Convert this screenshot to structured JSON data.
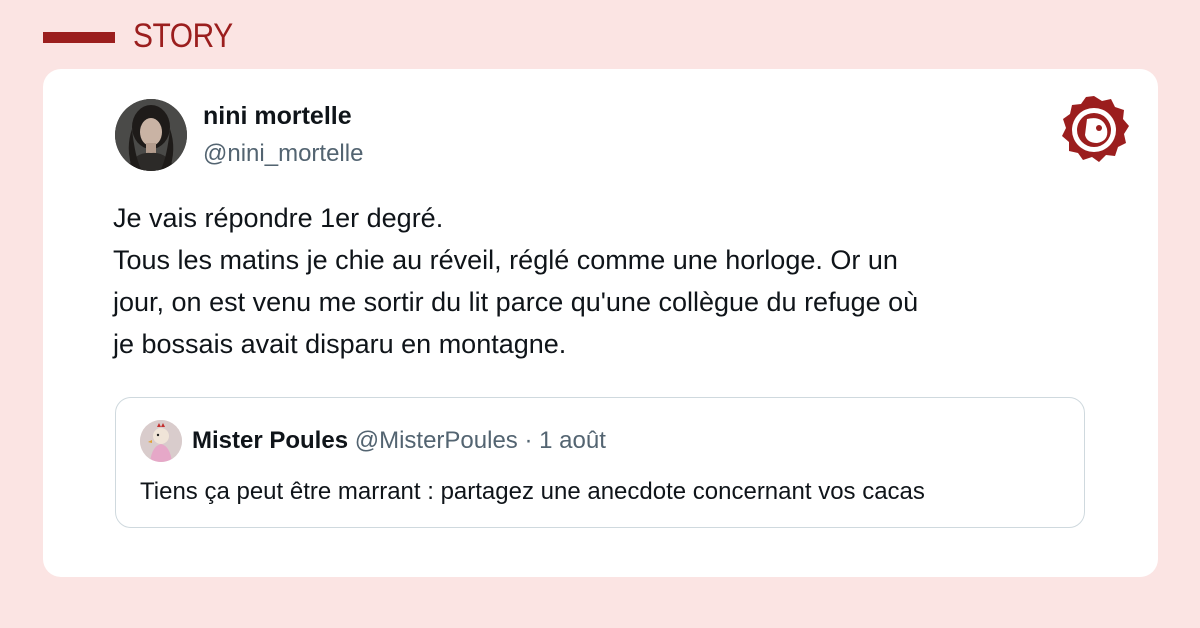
{
  "section": {
    "label": "STORY"
  },
  "tweet": {
    "author_name": "nini mortelle",
    "author_handle": "@nini_mortelle",
    "text_lines": [
      "Je vais répondre 1er degré.",
      "Tous les matins je chie au réveil, réglé comme une horloge. Or un",
      "jour, on est venu me sortir du lit parce qu'une collègue du refuge où",
      "je bossais avait disparu en montagne."
    ]
  },
  "quote": {
    "author_name": "Mister Poules",
    "author_handle": "@MisterPoules",
    "separator": "·",
    "date": "1 août",
    "text": "Tiens ça peut être marrant : partagez une anecdote concernant vos cacas"
  },
  "colors": {
    "background": "#fbe4e3",
    "accent": "#9b1e1e",
    "card": "#ffffff",
    "text_primary": "#0f1419",
    "text_secondary": "#536471"
  },
  "icons": {
    "brand": "brand-logo-icon"
  }
}
